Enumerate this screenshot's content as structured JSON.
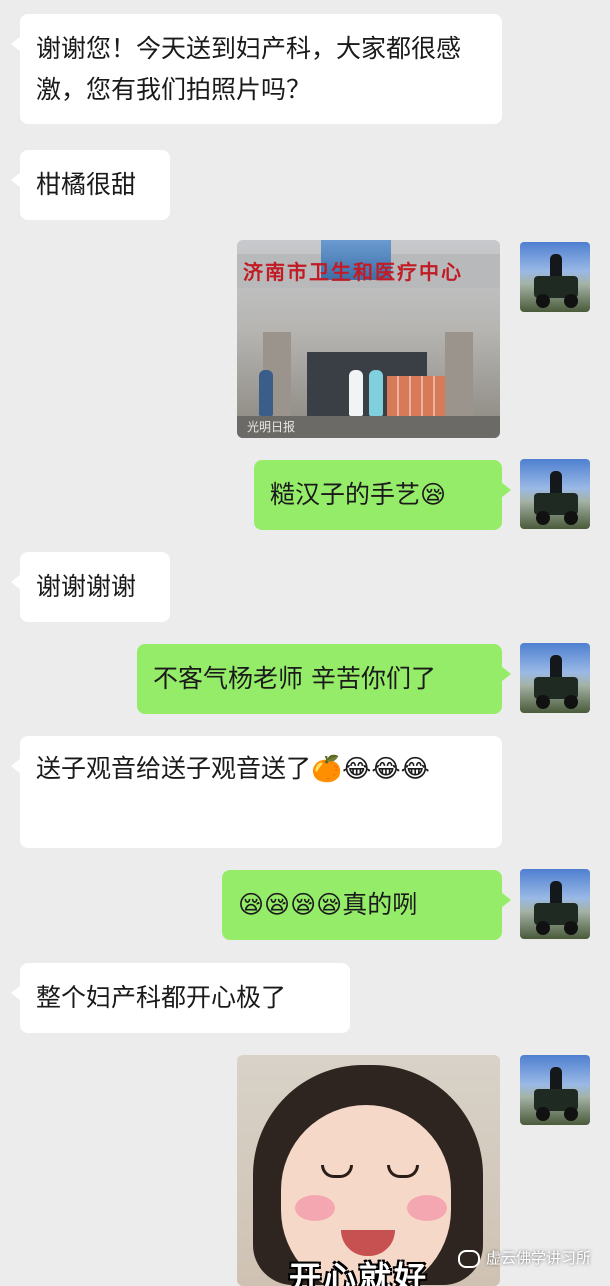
{
  "messages": [
    {
      "side": "in",
      "text": "谢谢您！今天送到妇产科，大家都很感激，您有我们拍照片吗？"
    },
    {
      "side": "in",
      "text": "柑橘很甜"
    },
    {
      "side": "out",
      "type": "image",
      "image_name": "hospital-delivery-photo",
      "sign_text": "济南市卫生和医疗中心",
      "watermark": "光明日报"
    },
    {
      "side": "out",
      "text": "糙汉子的手艺",
      "emoji": "😪"
    },
    {
      "side": "in",
      "text": "谢谢谢谢"
    },
    {
      "side": "out",
      "text": "不客气杨老师 辛苦你们了"
    },
    {
      "side": "in",
      "text": "送子观音给送子观音送了",
      "emoji": "🍊😂😂😂"
    },
    {
      "side": "out",
      "text": "真的咧",
      "emoji_before": "😪😪😪😪"
    },
    {
      "side": "in",
      "text": "整个妇产科都开心极了"
    },
    {
      "side": "out",
      "type": "image",
      "image_name": "smiling-girl-sticker",
      "caption": "开心就好"
    }
  ],
  "watermark": "虚云佛学讲习所",
  "colors": {
    "background": "#ececec",
    "incoming": "#ffffff",
    "outgoing": "#95ec69"
  }
}
